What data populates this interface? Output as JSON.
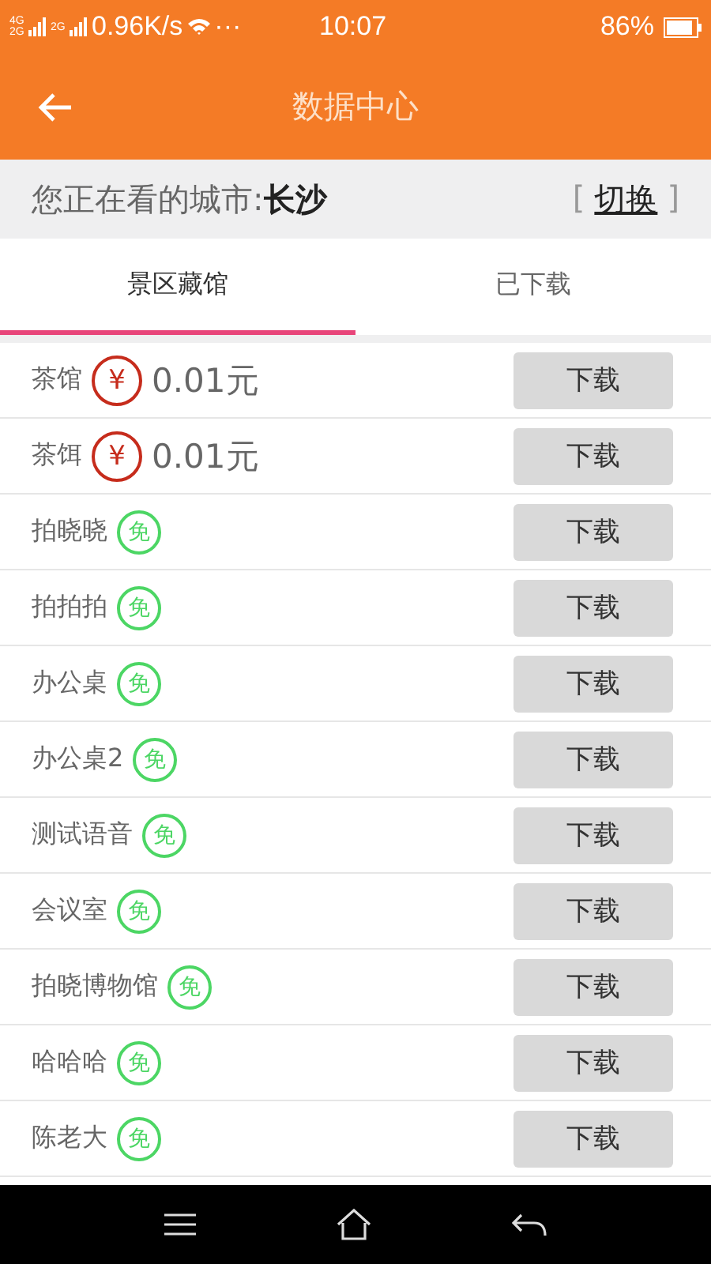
{
  "status_bar": {
    "net_1": "4G 2G",
    "net_2": "2G",
    "speed": "0.96K/s",
    "more": "···",
    "time": "10:07",
    "battery": "86%"
  },
  "header": {
    "title": "数据中心"
  },
  "city_bar": {
    "label": "您正在看的城市:",
    "city": "长沙",
    "bracket_open": "[",
    "switch": "切换",
    "bracket_close": "]"
  },
  "tabs": [
    {
      "label": "景区藏馆",
      "selected": true
    },
    {
      "label": "已下载",
      "selected": false
    }
  ],
  "items": [
    {
      "name": "茶馆",
      "kind": "paid",
      "badge": "¥",
      "price": "0.01元",
      "button": "下载"
    },
    {
      "name": "茶饵",
      "kind": "paid",
      "badge": "¥",
      "price": "0.01元",
      "button": "下载"
    },
    {
      "name": "拍晓晓",
      "kind": "free",
      "badge": "免",
      "button": "下载"
    },
    {
      "name": "拍拍拍",
      "kind": "free",
      "badge": "免",
      "button": "下载"
    },
    {
      "name": "办公桌",
      "kind": "free",
      "badge": "免",
      "button": "下载"
    },
    {
      "name": "办公桌2",
      "kind": "free",
      "badge": "免",
      "button": "下载"
    },
    {
      "name": "测试语音",
      "kind": "free",
      "badge": "免",
      "button": "下载"
    },
    {
      "name": "会议室",
      "kind": "free",
      "badge": "免",
      "button": "下载"
    },
    {
      "name": "拍晓博物馆",
      "kind": "free",
      "badge": "免",
      "button": "下载"
    },
    {
      "name": "哈哈哈",
      "kind": "free",
      "badge": "免",
      "button": "下载"
    },
    {
      "name": "陈老大",
      "kind": "free",
      "badge": "免",
      "button": "下载"
    }
  ]
}
